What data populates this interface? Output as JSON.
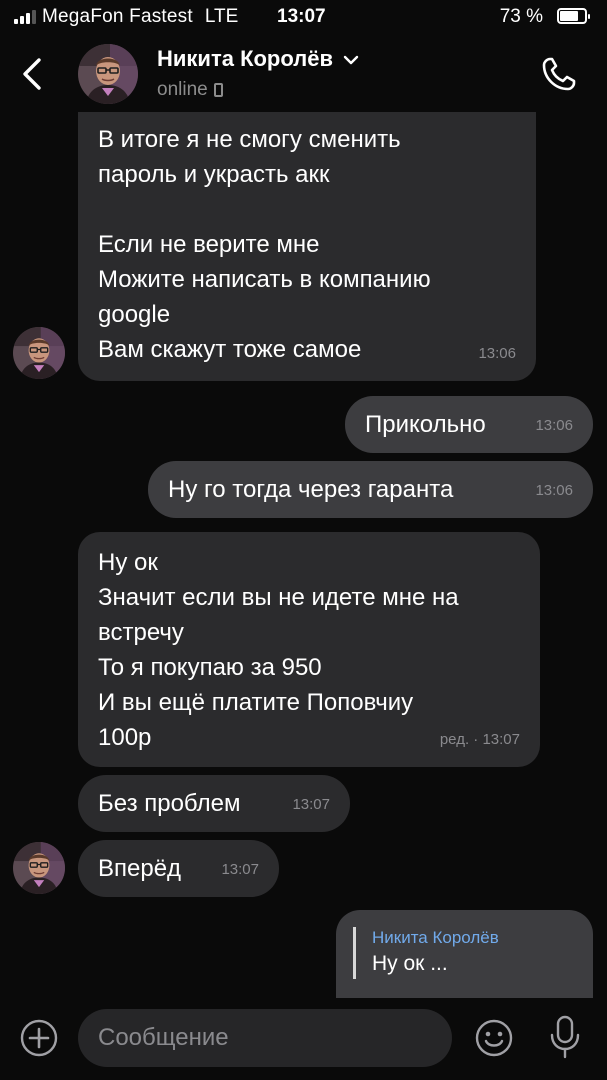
{
  "status_bar": {
    "carrier": "MegaFon Fastest",
    "network": "LTE",
    "time": "13:07",
    "battery": "73 %",
    "battery_level": 0.73,
    "signal_bars_active": 3
  },
  "header": {
    "contact_name": "Никита Королёв",
    "presence": "online"
  },
  "messages": [
    {
      "direction": "incoming",
      "lines": [
        "В итоге я не смогу сменить",
        "пароль и украсть акк",
        "",
        "Если не верите мне",
        "Можите написать в компанию",
        "google",
        "Вам скажут тоже самое"
      ],
      "time": "13:06"
    },
    {
      "direction": "outgoing",
      "lines": [
        "Прикольно"
      ],
      "time": "13:06"
    },
    {
      "direction": "outgoing",
      "lines": [
        "Ну го тогда через гаранта"
      ],
      "time": "13:06"
    },
    {
      "direction": "incoming",
      "lines": [
        "Ну ок",
        "Значит если вы не идете мне на",
        "встречу",
        "То я покупаю за 950",
        "И вы ещё платите Поповчиу",
        "100р"
      ],
      "time": "ред. · 13:07"
    },
    {
      "direction": "incoming",
      "lines": [
        "Без проблем"
      ],
      "time": "13:07"
    },
    {
      "direction": "incoming",
      "lines": [
        "Вперёд"
      ],
      "time": "13:07"
    },
    {
      "direction": "outgoing",
      "reply_to": {
        "author": "Никита Королёв",
        "text": "Ну ок ..."
      }
    }
  ],
  "composer": {
    "placeholder": "Сообщение"
  },
  "icons": {
    "back": "chevron-left-icon",
    "dropdown": "chevron-down-icon",
    "call": "phone-icon",
    "attach": "plus-circle-icon",
    "emoji": "smile-icon",
    "voice": "microphone-icon"
  },
  "colors": {
    "background": "#0a0a0a",
    "incoming_bubble": "#2b2b2d",
    "outgoing_bubble": "#3d3d40",
    "reply_author": "#71aaeb",
    "secondary_text": "#8a8a8e"
  }
}
